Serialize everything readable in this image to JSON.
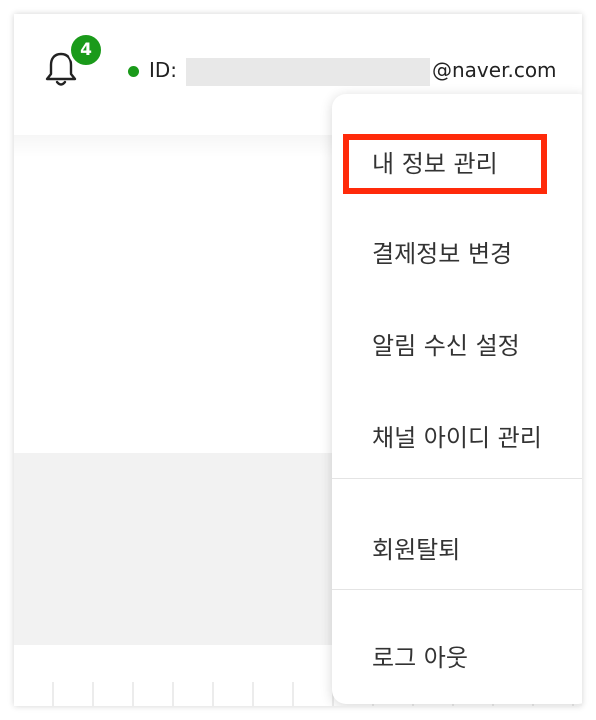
{
  "header": {
    "notification_count": "4",
    "id_label": "ID:",
    "id_domain": "@naver.com"
  },
  "colors": {
    "badge": "#1a9a1a",
    "status_online": "#1a9a1a",
    "highlight_box": "#ff2a0a"
  },
  "icons": {
    "notification": "bell-icon"
  },
  "menu": {
    "items": [
      {
        "label": "내 정보 관리",
        "highlighted": true
      },
      {
        "label": "결제정보 변경"
      },
      {
        "label": "알림 수신 설정"
      },
      {
        "label": "채널 아이디 관리"
      },
      {
        "label": "회원탈퇴"
      },
      {
        "label": "로그 아웃"
      }
    ]
  }
}
